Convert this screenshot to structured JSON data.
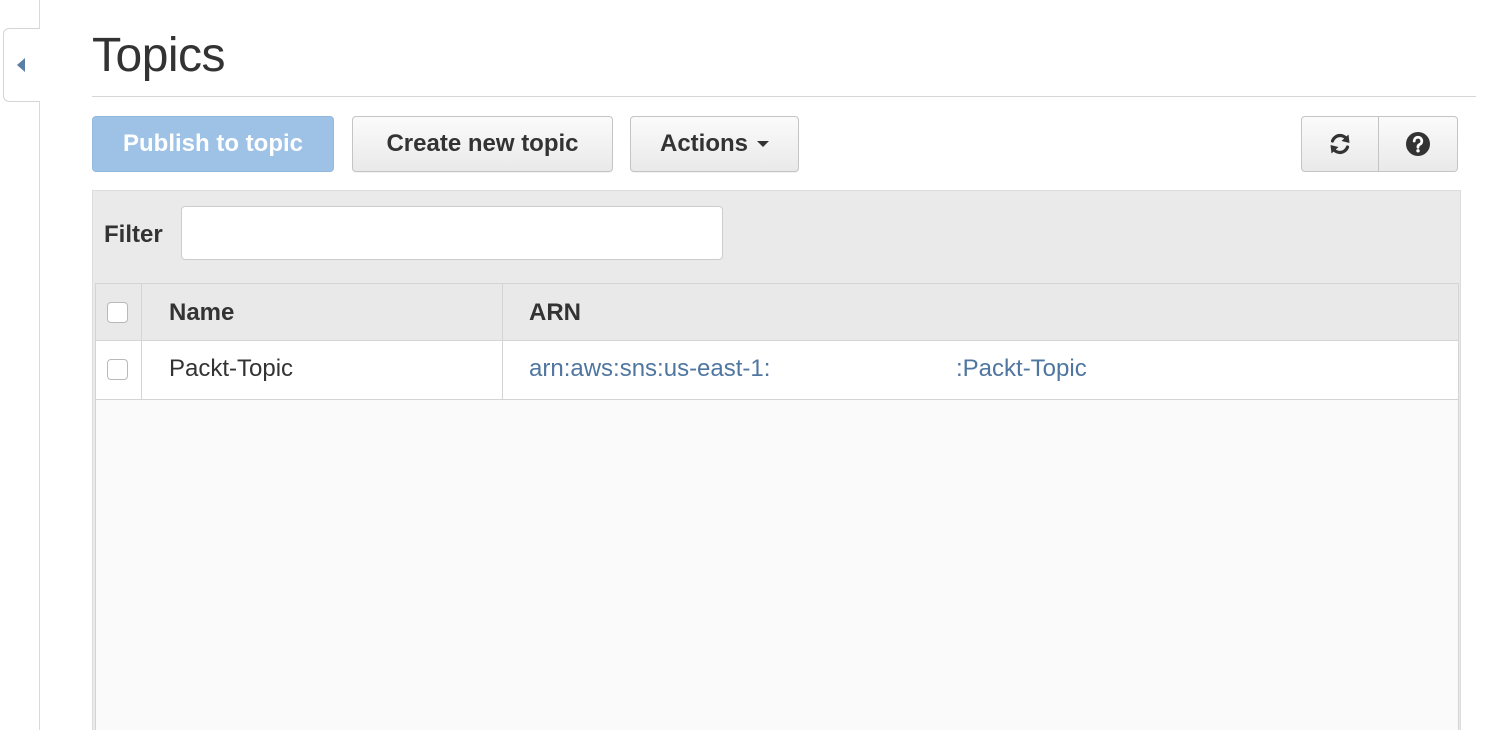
{
  "header": {
    "title": "Topics"
  },
  "toolbar": {
    "publish_label": "Publish to topic",
    "create_label": "Create new topic",
    "actions_label": "Actions",
    "refresh_icon": "refresh-icon",
    "help_icon": "help-icon"
  },
  "filter": {
    "label": "Filter",
    "value": "",
    "placeholder": ""
  },
  "table": {
    "columns": [
      "Name",
      "ARN"
    ],
    "rows": [
      {
        "name": "Packt-Topic",
        "arn_prefix": "arn:aws:sns:us-east-1:",
        "arn_suffix": ":Packt-Topic"
      }
    ]
  },
  "colors": {
    "primary_disabled": "#9ec2e6",
    "link": "#4f76a0"
  }
}
